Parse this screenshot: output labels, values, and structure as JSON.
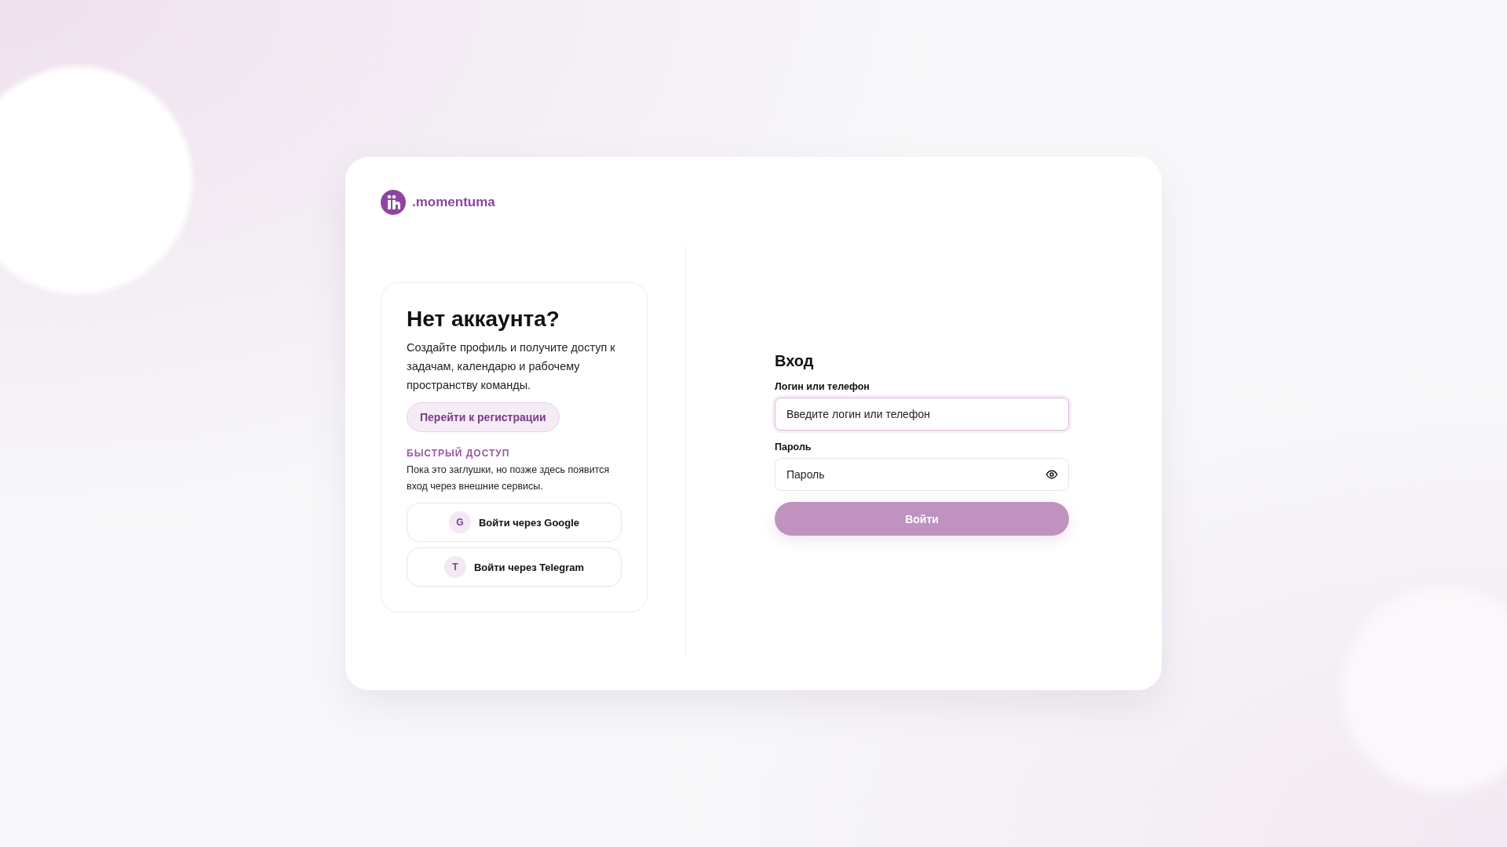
{
  "brand": {
    "name": ".momentuma"
  },
  "signup": {
    "title": "Нет аккаунта?",
    "text": "Создайте профиль и получите доступ к задачам, календарю и рабочему пространству команды.",
    "button": "Перейти к регистрации"
  },
  "quick_access": {
    "heading": "БЫСТРЫЙ ДОСТУП",
    "text": "Пока это заглушки, но позже здесь появится вход через внешние сервисы.",
    "providers": [
      {
        "letter": "G",
        "label": "Войти через Google"
      },
      {
        "letter": "T",
        "label": "Войти через Telegram"
      }
    ]
  },
  "login": {
    "title": "Вход",
    "fields": [
      {
        "kind": "text",
        "label": "Логин или телефон",
        "placeholder": "Введите логин или телефон",
        "focused": true
      },
      {
        "kind": "password",
        "label": "Пароль",
        "placeholder": "Пароль",
        "focused": false
      }
    ],
    "submit": {
      "label": "Войти",
      "disabled": true
    }
  }
}
